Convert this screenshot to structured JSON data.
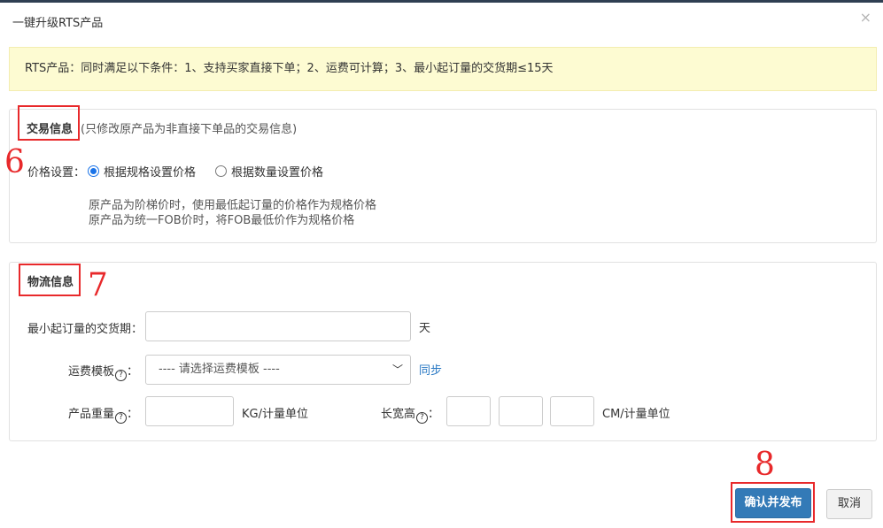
{
  "dialog": {
    "title": "一键升级RTS产品",
    "close_glyph": "×"
  },
  "notice": {
    "text": "RTS产品：同时满足以下条件：1、支持买家直接下单；2、运费可计算；3、最小起订量的交货期≤15天"
  },
  "trade": {
    "title": "交易信息",
    "note": "(只修改原产品为非直接下单品的交易信息)",
    "price_label": "价格设置：",
    "options": [
      {
        "label": "根据规格设置价格",
        "selected": true
      },
      {
        "label": "根据数量设置价格",
        "selected": false
      }
    ],
    "hints": [
      "原产品为阶梯价时，使用最低起订量的价格作为规格价格",
      "原产品为统一FOB价时，将FOB最低价作为规格价格"
    ]
  },
  "logistics": {
    "title": "物流信息",
    "lead_time_label": "最小起订量的交货期：",
    "lead_time_value": "",
    "lead_time_unit": "天",
    "template_label": "运费模板",
    "template_selected": "---- 请选择运费模板 ----",
    "sync_label": "同步",
    "weight_label": "产品重量",
    "weight_value": "",
    "weight_unit": "KG/计量单位",
    "dims_label": "长宽高",
    "dims_values": [
      "",
      "",
      ""
    ],
    "dims_unit": "CM/计量单位",
    "colon": "："
  },
  "annotations": [
    "6",
    "7",
    "8"
  ],
  "buttons": {
    "confirm": "确认并发布",
    "cancel": "取消"
  },
  "colors": {
    "annotation": "#e8292b",
    "primary": "#337ab7",
    "notice_bg": "#fdfbd2",
    "link": "#2a79c4"
  }
}
